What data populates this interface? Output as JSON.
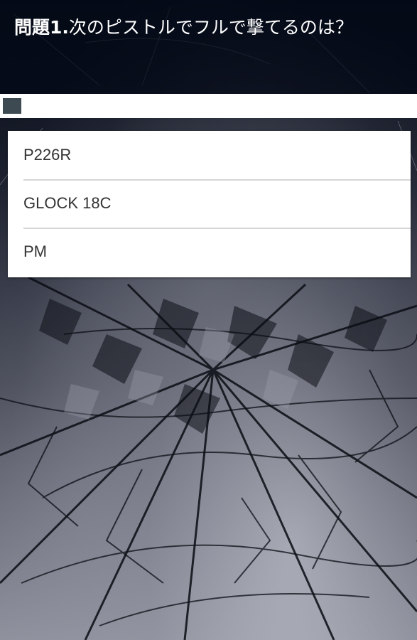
{
  "question": {
    "number_label": "問題1.",
    "text": "次のピストルでフルで撃てるのは？"
  },
  "progress": {
    "fraction": 0.045
  },
  "answers": [
    {
      "label": "P226R"
    },
    {
      "label": "GLOCK 18C"
    },
    {
      "label": "PM"
    }
  ],
  "colors": {
    "header_overlay": "#030816",
    "progress_fill": "#3d4a52",
    "answer_text": "#333333",
    "divider": "#d6d6d6"
  }
}
